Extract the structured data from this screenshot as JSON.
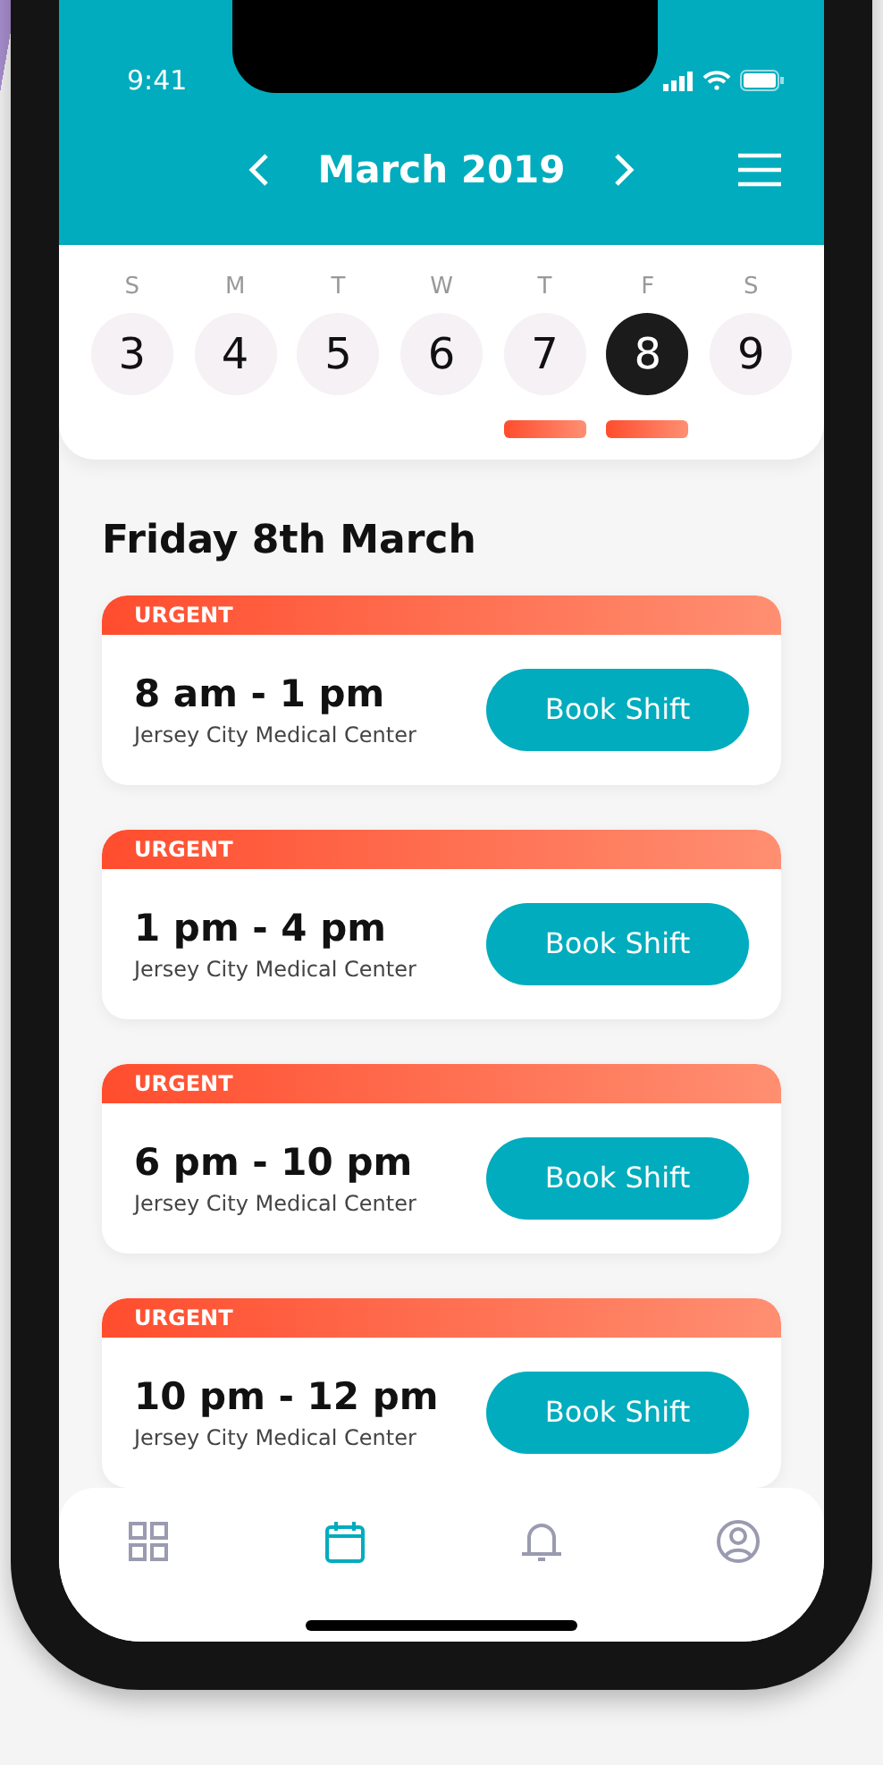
{
  "status_bar": {
    "time": "9:41"
  },
  "header": {
    "title": "March 2019"
  },
  "week": [
    {
      "weekday": "S",
      "day": "3",
      "selected": false,
      "has_shifts": false
    },
    {
      "weekday": "M",
      "day": "4",
      "selected": false,
      "has_shifts": false
    },
    {
      "weekday": "T",
      "day": "5",
      "selected": false,
      "has_shifts": false
    },
    {
      "weekday": "W",
      "day": "6",
      "selected": false,
      "has_shifts": false
    },
    {
      "weekday": "T",
      "day": "7",
      "selected": false,
      "has_shifts": true
    },
    {
      "weekday": "F",
      "day": "8",
      "selected": true,
      "has_shifts": true
    },
    {
      "weekday": "S",
      "day": "9",
      "selected": false,
      "has_shifts": false
    }
  ],
  "day_title": "Friday 8th March",
  "shifts": [
    {
      "tag": "URGENT",
      "time": "8 am - 1 pm",
      "location": "Jersey City Medical Center",
      "button": "Book Shift"
    },
    {
      "tag": "URGENT",
      "time": "1 pm - 4 pm",
      "location": "Jersey City Medical Center",
      "button": "Book Shift"
    },
    {
      "tag": "URGENT",
      "time": "6 pm - 10 pm",
      "location": "Jersey City Medical Center",
      "button": "Book Shift"
    },
    {
      "tag": "URGENT",
      "time": "10 pm - 12 pm",
      "location": "Jersey City Medical Center",
      "button": "Book Shift"
    }
  ],
  "tab_bar": [
    {
      "kind": "grid",
      "selected": false
    },
    {
      "kind": "calendar",
      "selected": true
    },
    {
      "kind": "bell",
      "selected": false
    },
    {
      "kind": "profile",
      "selected": false
    }
  ]
}
